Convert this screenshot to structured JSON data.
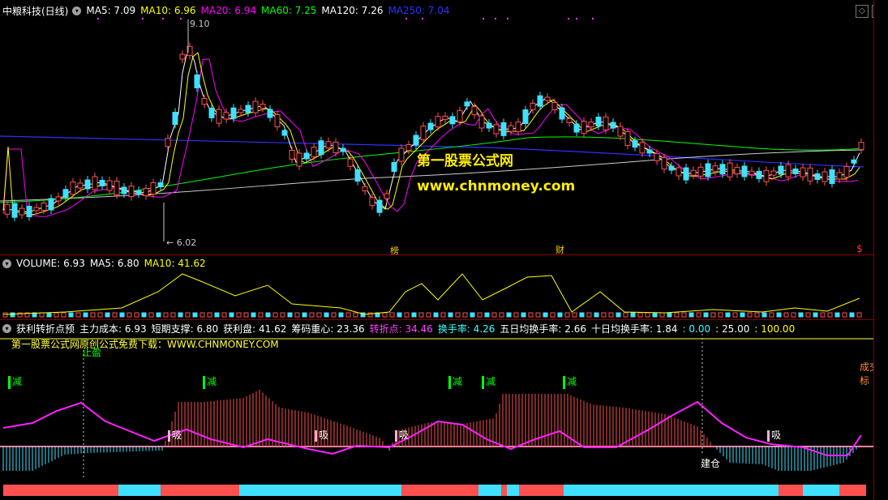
{
  "header": {
    "stock_title": "中粮科技(日线)",
    "ma": [
      {
        "label": "MA5: 7.09",
        "color": "#ffffff"
      },
      {
        "label": "MA10: 6.96",
        "color": "#ffff00"
      },
      {
        "label": "MA20: 6.94",
        "color": "#ff00ff"
      },
      {
        "label": "MA60: 7.25",
        "color": "#00ff00"
      },
      {
        "label": "MA120: 7.26",
        "color": "#ffffff"
      },
      {
        "label": "MA250: 7.04",
        "color": "#3030ff"
      }
    ]
  },
  "price_chart": {
    "high_label": "9.10",
    "low_label": "6.02",
    "watermark_title": "第一股票公式网",
    "watermark_url": "www.chnmoney.com",
    "markers": {
      "bang": "榜",
      "cai": "财",
      "dollar": "$"
    }
  },
  "volume_header": {
    "items": [
      {
        "label": "VOLUME: 6.93",
        "color": "#ffffff"
      },
      {
        "label": "MA5: 6.80",
        "color": "#ffffff"
      },
      {
        "label": "MA10: 41.62",
        "color": "#ffff00"
      }
    ]
  },
  "indicator_header": {
    "items": [
      {
        "label": "获利转折点预",
        "color": "#ffffff"
      },
      {
        "label": "主力成本: 6.93",
        "color": "#ffffff"
      },
      {
        "label": "短期支撑: 6.80",
        "color": "#ffffff"
      },
      {
        "label": "获利盘: 41.62",
        "color": "#ffffff"
      },
      {
        "label": "筹码重心: 23.36",
        "color": "#ffffff"
      },
      {
        "label": "转折点: 34.46",
        "color": "#ff40ff"
      },
      {
        "label": "换手率: 4.26",
        "color": "#40ffff"
      },
      {
        "label": "五日均换手率: 2.66",
        "color": "#ffffff"
      },
      {
        "label": "十日均换手率: 1.84",
        "color": "#ffffff"
      },
      {
        "label": ": 0.00",
        "color": "#40ffff"
      },
      {
        "label": ": 25.00",
        "color": "#ffffff"
      },
      {
        "label": ": 100.00",
        "color": "#ffff00"
      }
    ]
  },
  "indicator": {
    "promo": "第一股票公式网原创公式免费下载：WWW.CHNMONEY.COM",
    "stop_label": "止盈",
    "reduce_label": "减",
    "absorb_label": "吸",
    "build_label": "建仓",
    "volume_label": "成交标"
  },
  "colors": {
    "up": "#ff5050",
    "down": "#40e0ff",
    "ma5": "#ffffff",
    "ma10": "#ffff00",
    "ma20": "#ff00ff",
    "ma60": "#00ff00",
    "ma120": "#ffffff",
    "ma250": "#3030ff",
    "divider": "#8a0000",
    "magenta": "#ff20ff",
    "green": "#00ff00"
  },
  "icons": {
    "toggle": "chevron-down-icon",
    "restore": "restore-icon",
    "close": "close-icon"
  }
}
